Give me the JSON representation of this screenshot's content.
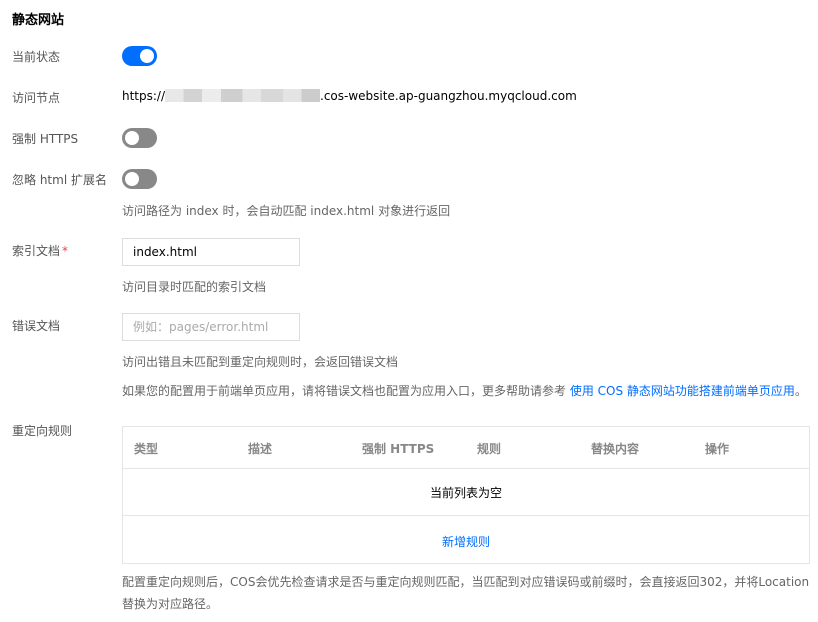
{
  "section": {
    "title": "静态网站"
  },
  "status": {
    "label": "当前状态",
    "enabled": true
  },
  "endpoint": {
    "label": "访问节点",
    "prefix": "https://",
    "suffix": ".cos-website.ap-guangzhou.myqcloud.com"
  },
  "force_https": {
    "label": "强制 HTTPS",
    "enabled": false
  },
  "ignore_ext": {
    "label": "忽略 html 扩展名",
    "enabled": false,
    "hint": "访问路径为 index 时，会自动匹配 index.html 对象进行返回"
  },
  "index_doc": {
    "label": "索引文档",
    "required_mark": "*",
    "value": "index.html",
    "hint": "访问目录时匹配的索引文档"
  },
  "error_doc": {
    "label": "错误文档",
    "value": "",
    "placeholder": "例如：pages/error.html",
    "hint": "访问出错且未匹配到重定向规则时，会返回错误文档",
    "help_text": "如果您的配置用于前端单页应用，请将错误文档也配置为应用入口，更多帮助请参考 ",
    "help_link": "使用 COS 静态网站功能搭建前端单页应用",
    "help_end": "。"
  },
  "redirect": {
    "label": "重定向规则",
    "columns": [
      "类型",
      "描述",
      "强制 HTTPS",
      "规则",
      "替换内容",
      "操作"
    ],
    "empty_text": "当前列表为空",
    "add_label": "新增规则",
    "note": "配置重定向规则后，COS会优先检查请求是否与重定向规则匹配，当匹配到对应错误码或前缀时，会直接返回302，并将Location替换为对应路径。"
  },
  "colors": {
    "accent": "#006eff",
    "toggle_off": "#888888",
    "required": "#e54545"
  }
}
